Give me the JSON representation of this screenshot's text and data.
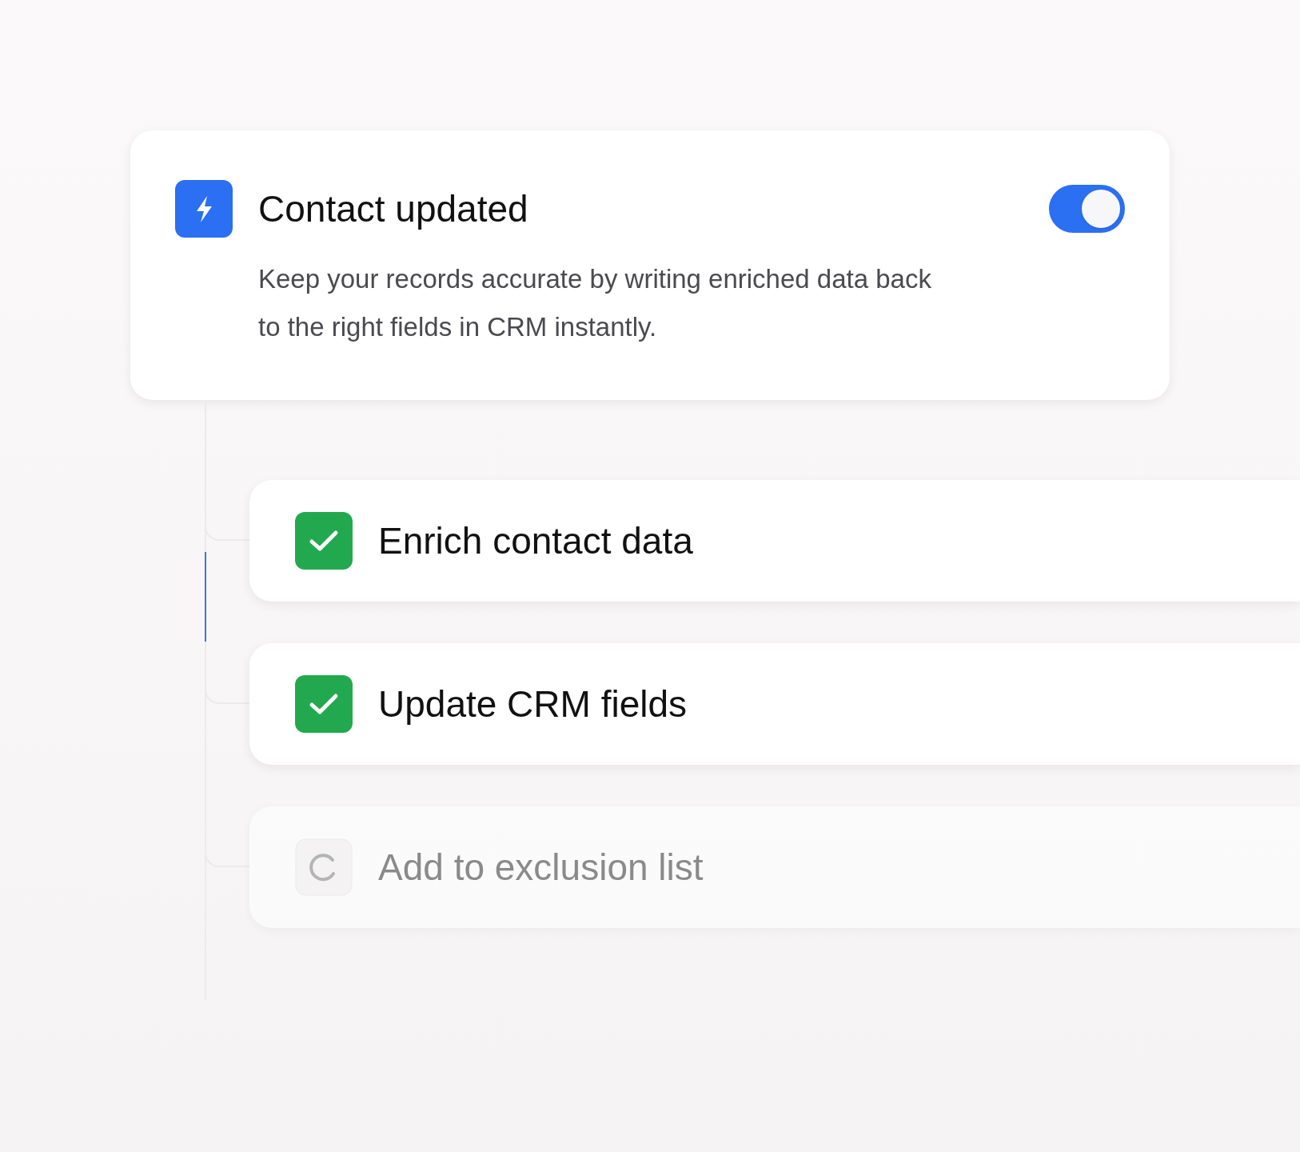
{
  "trigger": {
    "title": "Contact updated",
    "description": "Keep your records accurate by writing enriched data back to the right fields in CRM instantly.",
    "on": true
  },
  "steps": [
    {
      "label": "Enrich contact data",
      "done": true
    },
    {
      "label": "Update CRM fields",
      "done": true
    },
    {
      "label": "Add to exclusion list",
      "done": false
    }
  ]
}
